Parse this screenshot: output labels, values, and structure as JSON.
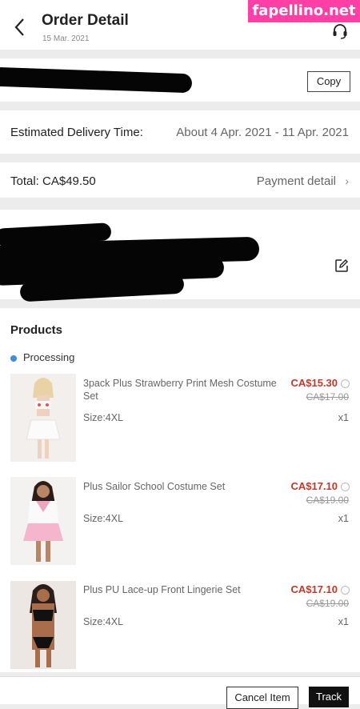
{
  "header": {
    "title": "Order Detail",
    "date": "15 Mar. 2021",
    "back_icon": "back-chevron-icon",
    "support_icon": "headset-icon"
  },
  "watermark": "fapellino.net",
  "order": {
    "copy_label": "Copy"
  },
  "delivery": {
    "label": "Estimated Delivery Time:",
    "value": "About 4 Apr. 2021 - 11 Apr. 2021"
  },
  "total": {
    "label": "Total: CA$49.50",
    "payment_link": "Payment detail"
  },
  "shipping": {
    "edit_icon": "edit-icon"
  },
  "products": {
    "heading": "Products",
    "status": "Processing",
    "status_color": "#3d8fd9",
    "price_color": "#c0392b",
    "items": [
      {
        "name": "3pack Plus Strawberry Print Mesh Costume Set",
        "price": "CA$15.30",
        "old_price": "CA$17.00",
        "size": "Size:4XL",
        "qty": "x1"
      },
      {
        "name": "Plus Sailor School Costume Set",
        "price": "CA$17.10",
        "old_price": "CA$19.00",
        "size": "Size:4XL",
        "qty": "x1"
      },
      {
        "name": "Plus PU Lace-up Front Lingerie Set",
        "price": "CA$17.10",
        "old_price": "CA$19.00",
        "size": "Size:4XL",
        "qty": "x1"
      }
    ]
  },
  "actions": {
    "cancel_label": "Cancel Item",
    "track_label": "Track"
  }
}
